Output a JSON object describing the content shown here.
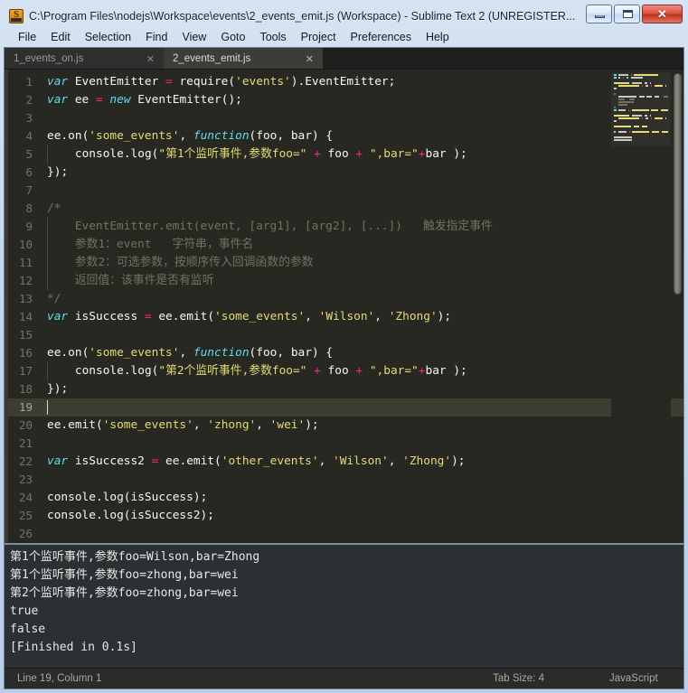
{
  "window": {
    "icon": "sublime-text-icon",
    "title": "C:\\Program Files\\nodejs\\Workspace\\events\\2_events_emit.js (Workspace) - Sublime Text 2 (UNREGISTER...",
    "controls": {
      "minimize": "minimize-icon",
      "maximize": "maximize-icon",
      "close": "✕"
    }
  },
  "menubar": {
    "items": [
      {
        "label": "File"
      },
      {
        "label": "Edit"
      },
      {
        "label": "Selection"
      },
      {
        "label": "Find"
      },
      {
        "label": "View"
      },
      {
        "label": "Goto"
      },
      {
        "label": "Tools"
      },
      {
        "label": "Project"
      },
      {
        "label": "Preferences"
      },
      {
        "label": "Help"
      }
    ]
  },
  "tabs": [
    {
      "label": "1_events_on.js",
      "close": "✕",
      "active": false
    },
    {
      "label": "2_events_emit.js",
      "close": "✕",
      "active": true
    }
  ],
  "editor": {
    "line_numbers": [
      1,
      2,
      3,
      4,
      5,
      6,
      7,
      8,
      9,
      10,
      11,
      12,
      13,
      14,
      15,
      16,
      17,
      18,
      19,
      20,
      21,
      22,
      23,
      24,
      25,
      26
    ],
    "current_line": 19,
    "lines": [
      {
        "n": 1,
        "text": "var EventEmitter = require('events').EventEmitter;"
      },
      {
        "n": 2,
        "text": "var ee = new EventEmitter();"
      },
      {
        "n": 3,
        "text": ""
      },
      {
        "n": 4,
        "text": "ee.on('some_events', function(foo, bar) {"
      },
      {
        "n": 5,
        "text": "    console.log(\"第1个监听事件,参数foo=\" + foo + \",bar=\"+bar );"
      },
      {
        "n": 6,
        "text": "});"
      },
      {
        "n": 7,
        "text": ""
      },
      {
        "n": 8,
        "text": "/*"
      },
      {
        "n": 9,
        "text": "    EventEmitter.emit(event, [arg1], [arg2], [...])   触发指定事件"
      },
      {
        "n": 10,
        "text": "    参数1：event   字符串，事件名"
      },
      {
        "n": 11,
        "text": "    参数2：可选参数，按顺序传入回调函数的参数"
      },
      {
        "n": 12,
        "text": "    返回值：该事件是否有监听"
      },
      {
        "n": 13,
        "text": "*/"
      },
      {
        "n": 14,
        "text": "var isSuccess = ee.emit('some_events', 'Wilson', 'Zhong');"
      },
      {
        "n": 15,
        "text": ""
      },
      {
        "n": 16,
        "text": "ee.on('some_events', function(foo, bar) {"
      },
      {
        "n": 17,
        "text": "    console.log(\"第2个监听事件,参数foo=\" + foo + \",bar=\"+bar );"
      },
      {
        "n": 18,
        "text": "});"
      },
      {
        "n": 19,
        "text": ""
      },
      {
        "n": 20,
        "text": "ee.emit('some_events', 'zhong', 'wei');"
      },
      {
        "n": 21,
        "text": ""
      },
      {
        "n": 22,
        "text": "var isSuccess2 = ee.emit('other_events', 'Wilson', 'Zhong');"
      },
      {
        "n": 23,
        "text": ""
      },
      {
        "n": 24,
        "text": "console.log(isSuccess);"
      },
      {
        "n": 25,
        "text": "console.log(isSuccess2);"
      },
      {
        "n": 26,
        "text": ""
      }
    ]
  },
  "console": {
    "lines": [
      "第1个监听事件,参数foo=Wilson,bar=Zhong",
      "第1个监听事件,参数foo=zhong,bar=wei",
      "第2个监听事件,参数foo=zhong,bar=wei",
      "true",
      "false",
      "[Finished in 0.1s]"
    ]
  },
  "statusbar": {
    "position": "Line 19, Column 1",
    "tab_size": "Tab Size: 4",
    "language": "JavaScript"
  },
  "colors": {
    "editor_bg": "#272822",
    "keyword": "#66d9ef",
    "operator": "#f92672",
    "string": "#e6db74",
    "comment": "#75715e",
    "foreground": "#f8f8f2",
    "current_line": "#3e3d32",
    "console_bg": "#2c2f33",
    "panel_border": "#7e8fa3",
    "titlebar_bg": "#c4d6ee"
  }
}
